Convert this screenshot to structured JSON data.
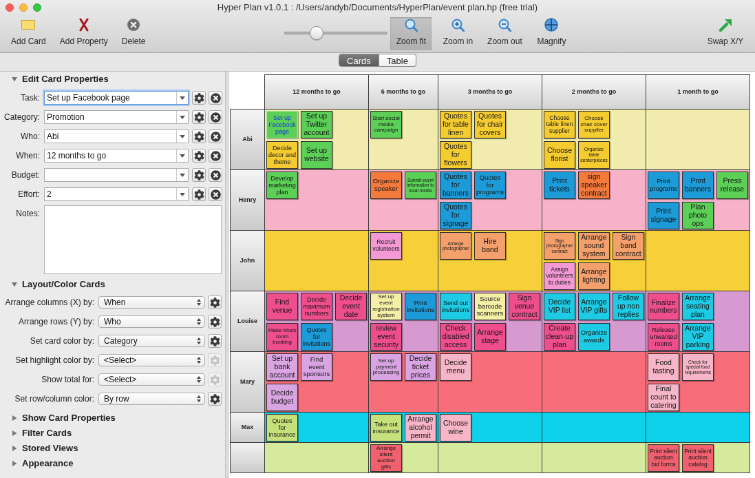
{
  "window": {
    "title": "Hyper Plan v1.0.1 : /Users/andyb/Documents/HyperPlan/event plan.hp (free trial)"
  },
  "toolbar": {
    "actions": [
      {
        "kind": "add-card",
        "label": "Add Card"
      },
      {
        "kind": "add-property",
        "label": "Add Property"
      },
      {
        "kind": "delete",
        "label": "Delete"
      }
    ],
    "zoom_slider": {
      "level": 0.28
    },
    "zoom_tools": [
      {
        "kind": "zoom-fit",
        "label": "Zoom fit",
        "selected": true
      },
      {
        "kind": "zoom-in",
        "label": "Zoom in",
        "selected": false
      },
      {
        "kind": "zoom-out",
        "label": "Zoom out",
        "selected": false
      },
      {
        "kind": "magnify",
        "label": "Magnify",
        "selected": false
      }
    ],
    "end_actions": [
      {
        "kind": "swap",
        "label": "Swap X/Y"
      }
    ]
  },
  "view_tabs": [
    {
      "label": "Cards",
      "selected": true
    },
    {
      "label": "Table",
      "selected": false
    }
  ],
  "sidebar": {
    "edit_card_properties": {
      "title": "Edit Card Properties",
      "expanded": true,
      "fields": [
        {
          "label": "Task:",
          "value": "Set up Facebook page",
          "focused": true
        },
        {
          "label": "Category:",
          "value": "Promotion",
          "focused": false
        },
        {
          "label": "Who:",
          "value": "Abi",
          "focused": false
        },
        {
          "label": "When:",
          "value": "12 months to go",
          "focused": false
        },
        {
          "label": "Budget:",
          "focused": false
        },
        {
          "label": "Effort:",
          "value": "2",
          "focused": false
        }
      ],
      "notes": {
        "label": "Notes:"
      }
    },
    "layout_color_cards": {
      "title": "Layout/Color Cards",
      "expanded": true,
      "options": [
        {
          "label": "Arrange columns (X) by:",
          "value": "When",
          "settings_disabled": false
        },
        {
          "label": "Arrange rows (Y) by:",
          "value": "Who",
          "settings_disabled": false
        },
        {
          "label": "Set card color by:",
          "value": "Category",
          "settings_disabled": false
        },
        {
          "label": "Set highlight color by:",
          "value": "<Select>",
          "settings_disabled": true
        },
        {
          "label": "Show total for:",
          "value": "<Select>",
          "settings_disabled": true
        },
        {
          "label": "Set row/column color:",
          "value": "By row",
          "settings_disabled": false
        }
      ]
    },
    "more_sections": [
      {
        "title": "Show Card Properties",
        "expanded": false
      },
      {
        "title": "Filter Cards",
        "expanded": false
      },
      {
        "title": "Stored Views",
        "expanded": false
      },
      {
        "title": "Appearance",
        "expanded": false
      }
    ]
  },
  "board": {
    "columns": [
      "12 months to go",
      "6 months to go",
      "3 months to go",
      "2 months to go",
      "1 month to go"
    ],
    "rows": [
      {
        "label": "Abi",
        "color": "#f1ecae",
        "cells": [
          [
            {
              "text": "Set up Facebook page",
              "color": "#5ccf57",
              "selected": true
            },
            {
              "text": "Set up Twitter account",
              "color": "#5ccf57",
              "selected": false
            },
            {
              "text": "Decide decor and theme",
              "color": "#f5cc30",
              "selected": false
            },
            {
              "text": "Set up website",
              "color": "#5ccf57",
              "selected": false
            }
          ],
          [
            {
              "text": "Start social media campaign",
              "color": "#5ccf57",
              "selected": false
            }
          ],
          [
            {
              "text": "Quotes for table linen",
              "color": "#f5cc30",
              "selected": false
            },
            {
              "text": "Quotes for chair covers",
              "color": "#f5cc30",
              "selected": false
            },
            {
              "text": "Quotes for flowers",
              "color": "#f5cc30",
              "selected": false
            }
          ],
          [
            {
              "text": "Choose table linen supplier",
              "color": "#f5cc30",
              "selected": false
            },
            {
              "text": "Choose chair cover supplier",
              "color": "#f5cc30",
              "selected": false
            },
            {
              "text": "Choose florist",
              "color": "#f5cc30",
              "selected": false
            },
            {
              "text": "Organize table centerpieces",
              "color": "#f5cc30",
              "selected": false
            }
          ],
          []
        ]
      },
      {
        "label": "Henry",
        "color": "#f7b2c9",
        "cells": [
          [
            {
              "text": "Develop marketing plan",
              "color": "#5ccf57",
              "selected": false
            }
          ],
          [
            {
              "text": "Organize speaker",
              "color": "#f47a3c",
              "selected": false
            },
            {
              "text": "Submit event information to local media",
              "color": "#5ccf57",
              "selected": false
            }
          ],
          [
            {
              "text": "Quotes for banners",
              "color": "#1c9bd8",
              "selected": false
            },
            {
              "text": "Quotes for programs",
              "color": "#1c9bd8",
              "selected": false
            },
            {
              "text": "Quotes for signage",
              "color": "#1c9bd8",
              "selected": false
            }
          ],
          [
            {
              "text": "Print tickets",
              "color": "#1c9bd8",
              "selected": false
            },
            {
              "text": "sign speaker contract",
              "color": "#f47a3c",
              "selected": false
            }
          ],
          [
            {
              "text": "Print programs",
              "color": "#1c9bd8",
              "selected": false
            },
            {
              "text": "Print banners",
              "color": "#1c9bd8",
              "selected": false
            },
            {
              "text": "Press release",
              "color": "#5ccf57",
              "selected": false
            },
            {
              "text": "Print signage",
              "color": "#1c9bd8",
              "selected": false
            },
            {
              "text": "Plan photo ops",
              "color": "#5ccf57",
              "selected": false
            }
          ]
        ]
      },
      {
        "label": "John",
        "color": "#f7cf38",
        "cells": [
          [],
          [
            {
              "text": "Recruit volunteers",
              "color": "#f39ad6",
              "selected": false
            }
          ],
          [
            {
              "text": "Arrange photographer",
              "color": "#f4a06c",
              "selected": false
            },
            {
              "text": "Hire band",
              "color": "#f4a06c",
              "selected": false
            }
          ],
          [
            {
              "text": "Sign photographer contract",
              "color": "#f4a06c",
              "selected": false
            },
            {
              "text": "Arrange sound system",
              "color": "#f4a06c",
              "selected": false
            },
            {
              "text": "Sign band contract",
              "color": "#f4a06c",
              "selected": false
            },
            {
              "text": "Assign volunteers to duties",
              "color": "#f39ad6",
              "selected": false
            },
            {
              "text": "Arrange lighting",
              "color": "#f4a06c",
              "selected": false
            }
          ],
          []
        ]
      },
      {
        "label": "Louise",
        "color": "#d69ad0",
        "cells": [
          [
            {
              "text": "Find venue",
              "color": "#ee4f8c",
              "selected": false
            },
            {
              "text": "Decide maximum numbers",
              "color": "#ee4f8c",
              "selected": false
            },
            {
              "text": "Decide event date",
              "color": "#ee4f8c",
              "selected": false
            },
            {
              "text": "Make block room booking",
              "color": "#ee4f8c",
              "selected": false
            },
            {
              "text": "Quotes for invitations",
              "color": "#1c9bd8",
              "selected": false
            }
          ],
          [
            {
              "text": "Set up event registration system",
              "color": "#f3efa6",
              "selected": false
            },
            {
              "text": "Print invitations",
              "color": "#1c9bd8",
              "selected": false
            },
            {
              "text": "review event security",
              "color": "#ee4f8c",
              "selected": false
            }
          ],
          [
            {
              "text": "Send out invitations",
              "color": "#1dcbe4",
              "selected": false
            },
            {
              "text": "Source barcode scanners",
              "color": "#f3efa6",
              "selected": false
            },
            {
              "text": "Sign venue contract",
              "color": "#ee4f8c",
              "selected": false
            },
            {
              "text": "Check disabled access",
              "color": "#ee4f8c",
              "selected": false
            },
            {
              "text": "Arrange stage",
              "color": "#ee4f8c",
              "selected": false
            }
          ],
          [
            {
              "text": "Decide VIP list",
              "color": "#1dcbe4",
              "selected": false
            },
            {
              "text": "Arrange VIP gifts",
              "color": "#1dcbe4",
              "selected": false
            },
            {
              "text": "Follow up non replies",
              "color": "#1dcbe4",
              "selected": false
            },
            {
              "text": "Create clean-up plan",
              "color": "#ee4f8c",
              "selected": false
            },
            {
              "text": "Organize awards",
              "color": "#1dcbe4",
              "selected": false
            }
          ],
          [
            {
              "text": "Finalize numbers",
              "color": "#ee4f8c",
              "selected": false
            },
            {
              "text": "Arrange seating plan",
              "color": "#1dcbe4",
              "selected": false
            },
            {
              "text": "Release unwanted rooms",
              "color": "#ee4f8c",
              "selected": false
            },
            {
              "text": "Arrange VIP parking",
              "color": "#1dcbe4",
              "selected": false
            }
          ]
        ]
      },
      {
        "label": "Mary",
        "color": "#f76d79",
        "cells": [
          [
            {
              "text": "Set up bank account",
              "color": "#d9a4e2",
              "selected": false
            },
            {
              "text": "Find event sponsors",
              "color": "#d9a4e2",
              "selected": false
            },
            {
              "text": "Decide budget",
              "color": "#d9a4e2",
              "selected": false
            }
          ],
          [
            {
              "text": "Set up payment processing",
              "color": "#d9a4e2",
              "selected": false
            },
            {
              "text": "Decide ticket prices",
              "color": "#d9a4e2",
              "selected": false
            }
          ],
          [
            {
              "text": "Decide menu",
              "color": "#f6b5c8",
              "selected": false
            }
          ],
          [],
          [
            {
              "text": "Food tasting",
              "color": "#f6b5c8",
              "selected": false
            },
            {
              "text": "Check for special food requirements",
              "color": "#f6b5c8",
              "selected": false
            },
            {
              "text": "Final count to catering",
              "color": "#f6b5c8",
              "selected": false
            }
          ]
        ]
      },
      {
        "label": "Max",
        "color": "#0fd2ea",
        "cells": [
          [
            {
              "text": "Quotes for insurance",
              "color": "#c6e07a",
              "selected": false
            }
          ],
          [
            {
              "text": "Take out insurance",
              "color": "#c6e07a",
              "selected": false
            },
            {
              "text": "Arrange alcohol permit",
              "color": "#f6b5c8",
              "selected": false
            }
          ],
          [
            {
              "text": "Choose wine",
              "color": "#f6b5c8",
              "selected": false
            }
          ],
          [],
          []
        ]
      },
      {
        "color": "#d5ea9c",
        "cells": [
          [],
          [
            {
              "text": "Arrange silent auction gifts",
              "color": "#f0606e",
              "selected": false
            }
          ],
          [],
          [],
          [
            {
              "text": "Print silent auction bid forms",
              "color": "#f0606e",
              "selected": false
            },
            {
              "text": "Print silent auction catalog",
              "color": "#f0606e",
              "selected": false
            }
          ]
        ]
      }
    ]
  }
}
